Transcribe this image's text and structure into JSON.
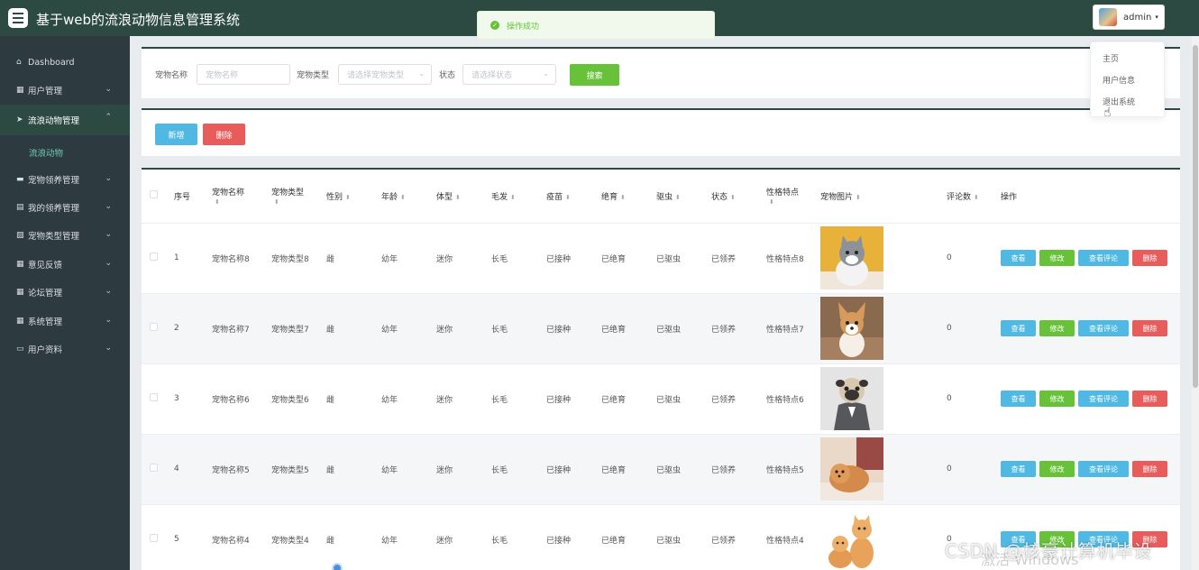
{
  "header": {
    "app_title": "基于web的流浪动物信息管理系统",
    "user_name": "admin",
    "caret": "▾"
  },
  "toast": {
    "message": "操作成功",
    "icon": "check-circle-icon"
  },
  "user_menu": [
    "主页",
    "用户信息",
    "退出系统"
  ],
  "sidebar": {
    "items": [
      {
        "label": "Dashboard",
        "icon": "home-icon"
      },
      {
        "label": "用户管理",
        "icon": "grid-icon"
      },
      {
        "label": "流浪动物管理",
        "icon": "send-icon"
      },
      {
        "label": "流浪动物",
        "icon": ""
      },
      {
        "label": "宠物领养管理",
        "icon": "briefcase-icon"
      },
      {
        "label": "我的领养管理",
        "icon": "document-icon"
      },
      {
        "label": "宠物类型管理",
        "icon": "picture-icon"
      },
      {
        "label": "意见反馈",
        "icon": "grid-icon"
      },
      {
        "label": "论坛管理",
        "icon": "grid-icon"
      },
      {
        "label": "系统管理",
        "icon": "grid-icon"
      },
      {
        "label": "用户资料",
        "icon": "window-icon"
      }
    ]
  },
  "search": {
    "name_label": "宠物名称",
    "name_placeholder": "宠物名称",
    "type_label": "宠物类型",
    "type_placeholder": "请选择宠物类型",
    "status_label": "状态",
    "status_placeholder": "请选择状态",
    "search_button": "搜索"
  },
  "actions": {
    "add_button": "新增",
    "delete_button": "删除"
  },
  "table": {
    "columns": [
      "序号",
      "宠物名称",
      "宠物类型",
      "性别",
      "年龄",
      "体型",
      "毛发",
      "疫苗",
      "绝育",
      "驱虫",
      "状态",
      "性格特点",
      "宠物图片",
      "评论数",
      "操作"
    ],
    "op_labels": {
      "view": "查看",
      "edit": "修改",
      "view_comments": "查看评论",
      "delete": "删除"
    },
    "rows": [
      {
        "idx": "1",
        "name": "宠物名称8",
        "type": "宠物类型8",
        "gender": "雌",
        "age": "幼年",
        "size": "迷你",
        "hair": "长毛",
        "vaccine": "已接种",
        "sterilized": "已绝育",
        "dewormed": "已驱虫",
        "status": "已领养",
        "trait": "性格特点8",
        "image": "grey-white-kitten",
        "comments": "0"
      },
      {
        "idx": "2",
        "name": "宠物名称7",
        "type": "宠物类型7",
        "gender": "雌",
        "age": "幼年",
        "size": "迷你",
        "hair": "长毛",
        "vaccine": "已接种",
        "sterilized": "已绝育",
        "dewormed": "已驱虫",
        "status": "已领养",
        "trait": "性格特点7",
        "image": "corgi-puppy",
        "comments": "0"
      },
      {
        "idx": "3",
        "name": "宠物名称6",
        "type": "宠物类型6",
        "gender": "雌",
        "age": "幼年",
        "size": "迷你",
        "hair": "长毛",
        "vaccine": "已接种",
        "sterilized": "已绝育",
        "dewormed": "已驱虫",
        "status": "已领养",
        "trait": "性格特点6",
        "image": "pug-in-suit",
        "comments": "0"
      },
      {
        "idx": "4",
        "name": "宠物名称5",
        "type": "宠物类型5",
        "gender": "雌",
        "age": "幼年",
        "size": "迷你",
        "hair": "长毛",
        "vaccine": "已接种",
        "sterilized": "已绝育",
        "dewormed": "已驱虫",
        "status": "已领养",
        "trait": "性格特点5",
        "image": "pomeranian-puppy",
        "comments": "0"
      },
      {
        "idx": "5",
        "name": "宠物名称4",
        "type": "宠物类型4",
        "gender": "雌",
        "age": "幼年",
        "size": "迷你",
        "hair": "长毛",
        "vaccine": "已接种",
        "sterilized": "已绝育",
        "dewormed": "已驱虫",
        "status": "已领养",
        "trait": "性格特点4",
        "image": "two-orange-kittens",
        "comments": "0"
      }
    ]
  },
  "overlay": {
    "watermark": "CSDN @核豪计算机毕设",
    "watermark2": "激活 Windows"
  },
  "colors": {
    "header": "#2d4a42",
    "sidebar": "#2d3a3f",
    "blue": "#4fb9e3",
    "green": "#67c23a",
    "red": "#e85c5c"
  }
}
